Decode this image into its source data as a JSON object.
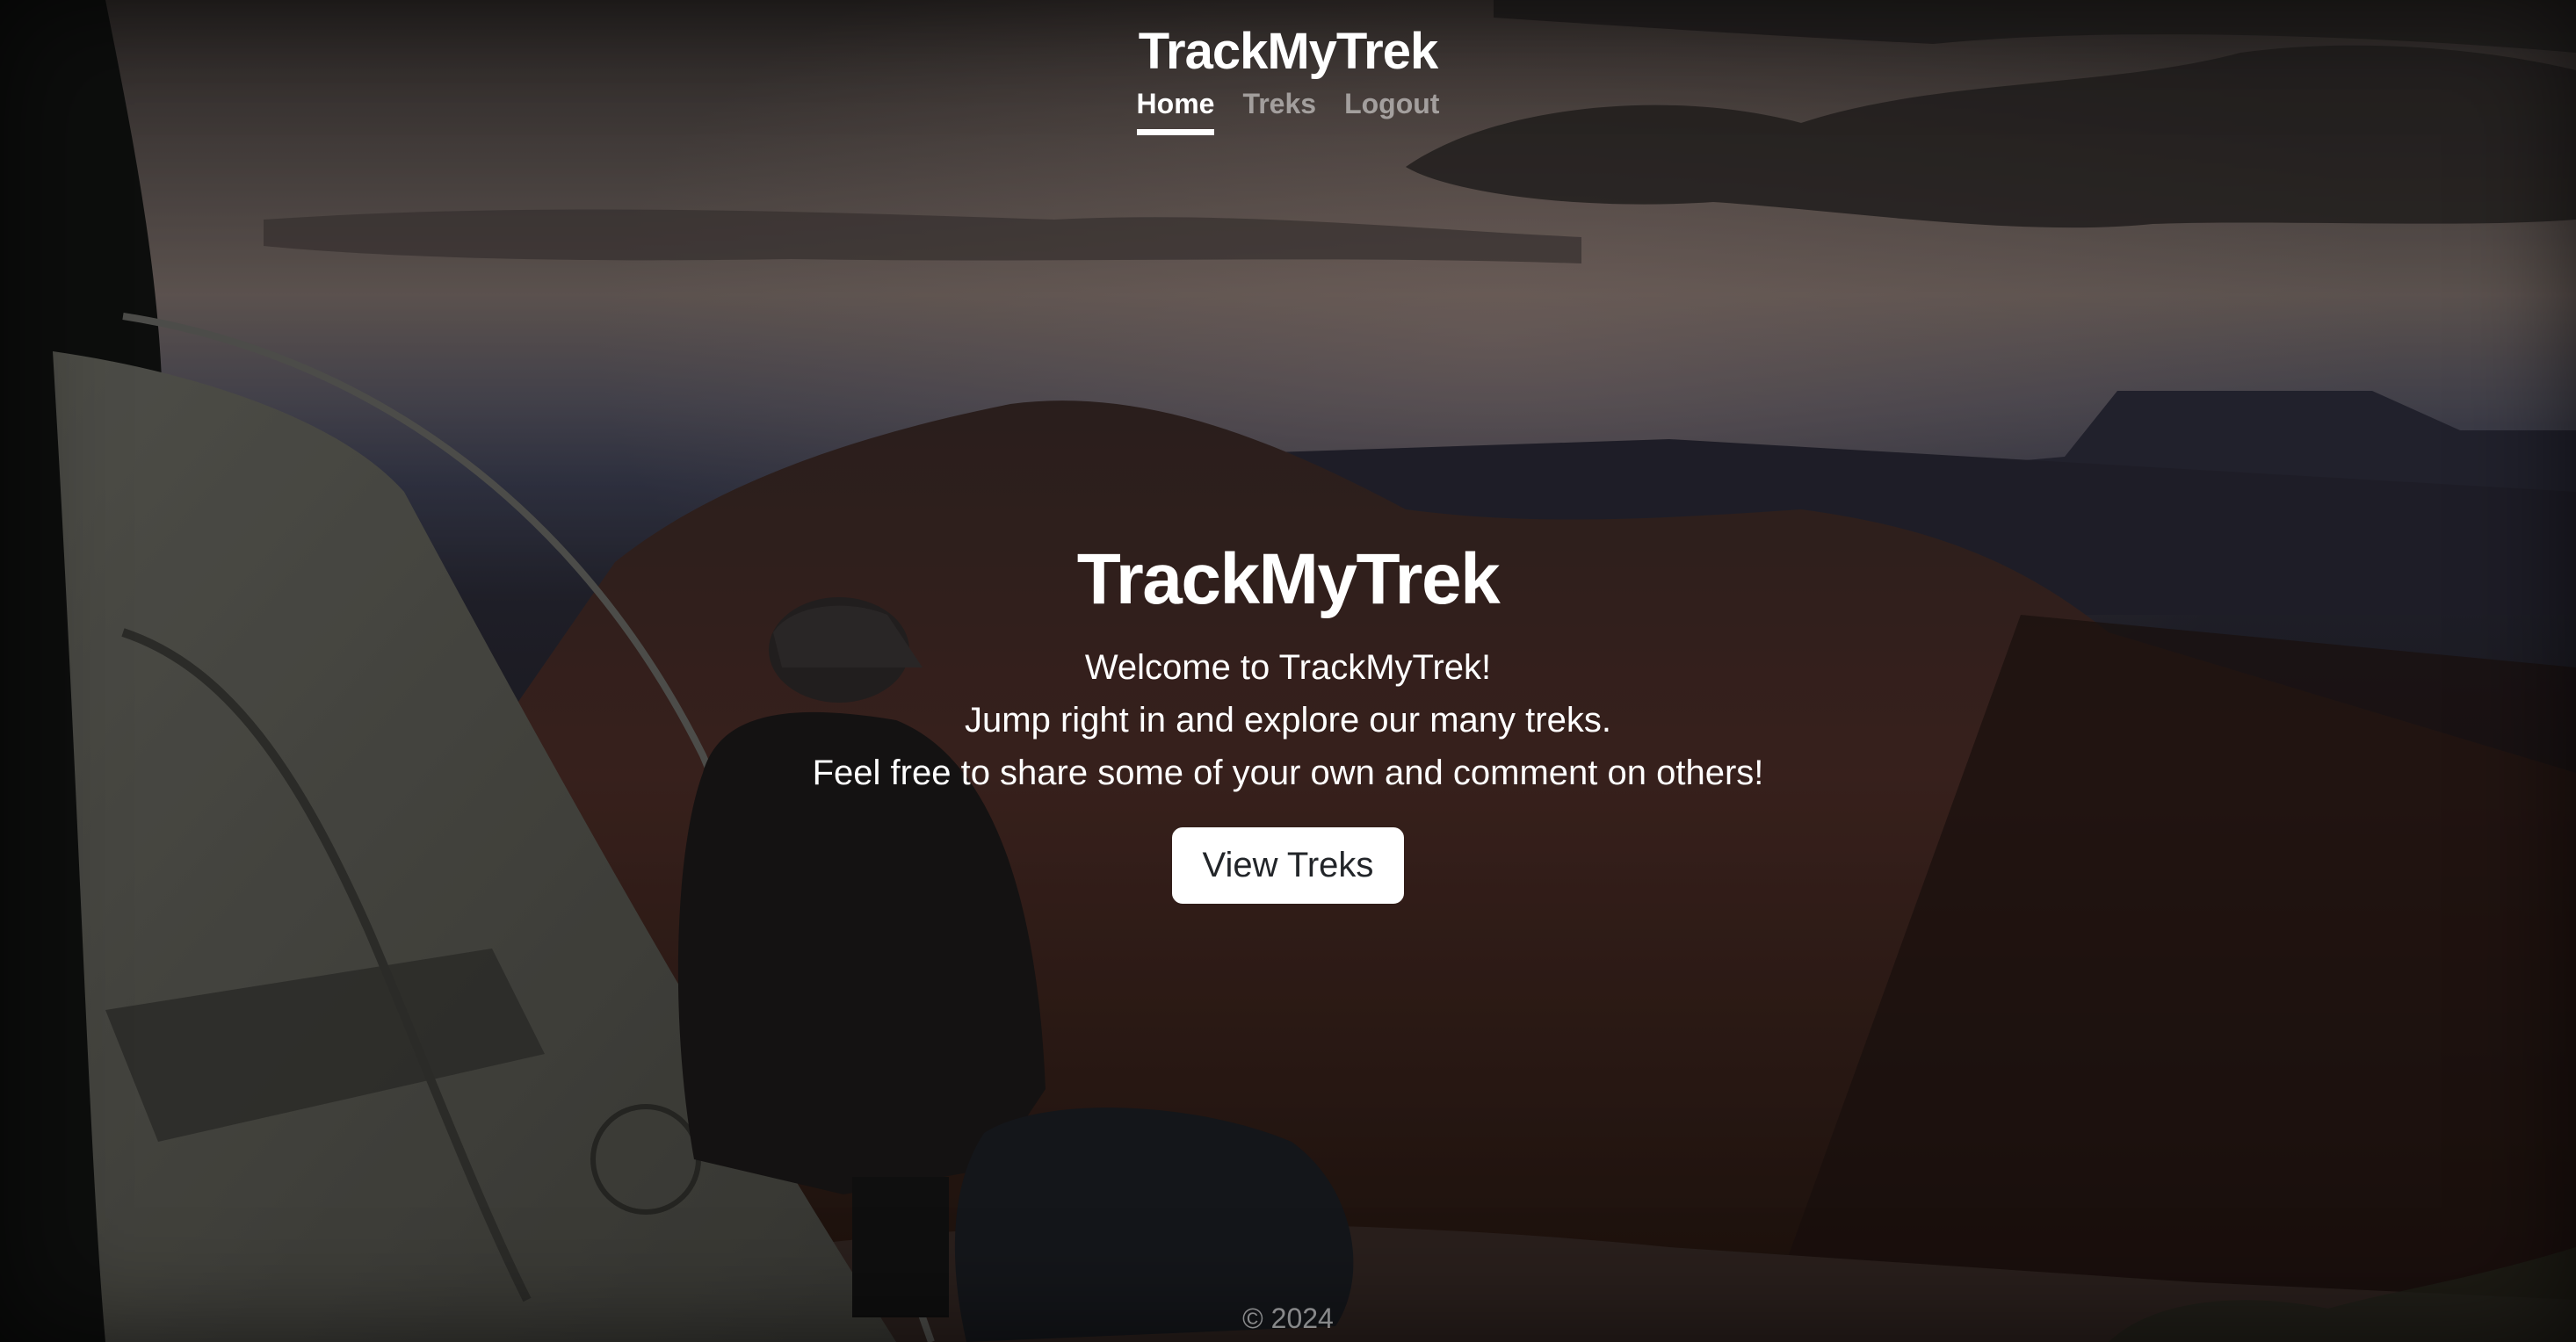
{
  "header": {
    "brand": "TrackMyTrek",
    "nav": [
      {
        "label": "Home",
        "active": true
      },
      {
        "label": "Treks",
        "active": false
      },
      {
        "label": "Logout",
        "active": false
      }
    ]
  },
  "hero": {
    "title": "TrackMyTrek",
    "lines": [
      "Welcome to TrackMyTrek!",
      "Jump right in and explore our many treks.",
      "Feel free to share some of your own and comment on others!"
    ],
    "button_label": "View Treks"
  },
  "footer": {
    "copyright": "© 2024"
  },
  "background": {
    "description_icon": "mountain-camp-photo",
    "sky_top": "#3a3432",
    "sky_mid": "#7a6a66",
    "mesa": "#3b2622",
    "ground": "#2b1c19"
  }
}
